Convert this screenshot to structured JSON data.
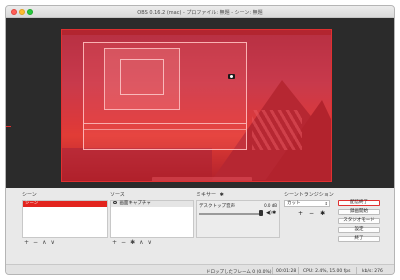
{
  "window": {
    "title": "OBS 0.16.2 (mac) - プロファイル: 無題 - シーン: 無題"
  },
  "docks": {
    "scenes_header": "シーン",
    "sources_header": "ソース",
    "mixer_header": "ミキサー",
    "transitions_header": "シーントランジション",
    "scene_items": [
      "シーン"
    ],
    "source_items": [
      "画面キャプチャ"
    ]
  },
  "mixer": {
    "track_name": "デスクトップ音声",
    "level": "0.0 dB",
    "volume_fraction": 1.0
  },
  "transitions": {
    "selected": "カット"
  },
  "icons": {
    "add": "+",
    "remove": "−",
    "gear": "✱",
    "up": "∧",
    "down": "∨",
    "speaker": "◀)",
    "chevron": "⇕"
  },
  "controls": {
    "start_stream": "配信終了",
    "start_record": "録画開始",
    "studio_mode": "スタジオモード",
    "settings": "設定",
    "exit": "終了"
  },
  "status": {
    "dropped": "ドロップしたフレーム 0 (0.0%)",
    "time": "00:01:28",
    "cpu": "CPU: 2.4%, 15.00 fps",
    "kbps": "kb/s: 276"
  },
  "colors": {
    "scene_selected": "#e2241e",
    "accent": "#e03030"
  }
}
